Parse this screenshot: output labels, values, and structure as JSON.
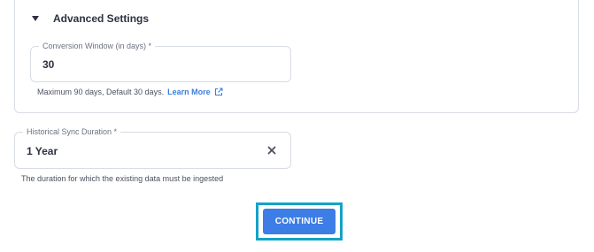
{
  "advanced_settings": {
    "title": "Advanced Settings",
    "conversion_window": {
      "label": "Conversion Window (in days) *",
      "value": "30",
      "helper": "Maximum 90 days, Default 30 days.",
      "link_label": "Learn More"
    }
  },
  "historical_sync": {
    "label": "Historical Sync Duration *",
    "value": "1 Year",
    "helper": "The duration for which the existing data must be ingested"
  },
  "actions": {
    "continue_label": "CONTINUE"
  },
  "colors": {
    "accent": "#3d7de6",
    "link": "#3b7ddd",
    "focus_frame": "#14a3c7",
    "border": "#d8dce4"
  },
  "icons": {
    "caret": "caret-down-icon",
    "external": "external-link-icon",
    "clear": "close-icon"
  }
}
